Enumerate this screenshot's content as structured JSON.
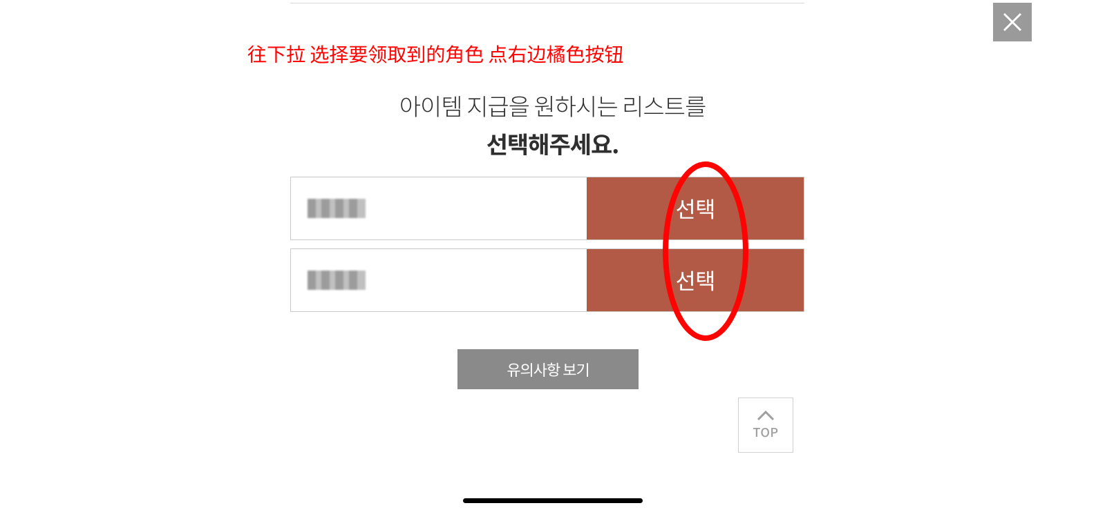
{
  "annotation": {
    "instruction_text": "往下拉 选择要领取到的角色 点右边橘色按钮"
  },
  "title": {
    "line1": "아이템 지급을 원하시는 리스트를",
    "line2": "선택해주세요."
  },
  "character_list": [
    {
      "name_obscured": true,
      "select_label": "선택"
    },
    {
      "name_obscured": true,
      "select_label": "선택"
    }
  ],
  "buttons": {
    "notice": "유의사항 보기",
    "top": "TOP"
  },
  "colors": {
    "accent_orange": "#b25a46",
    "instruction_red": "#ff0303",
    "grey_button": "#8a8a8a",
    "close_bg": "#9a9a9a"
  }
}
